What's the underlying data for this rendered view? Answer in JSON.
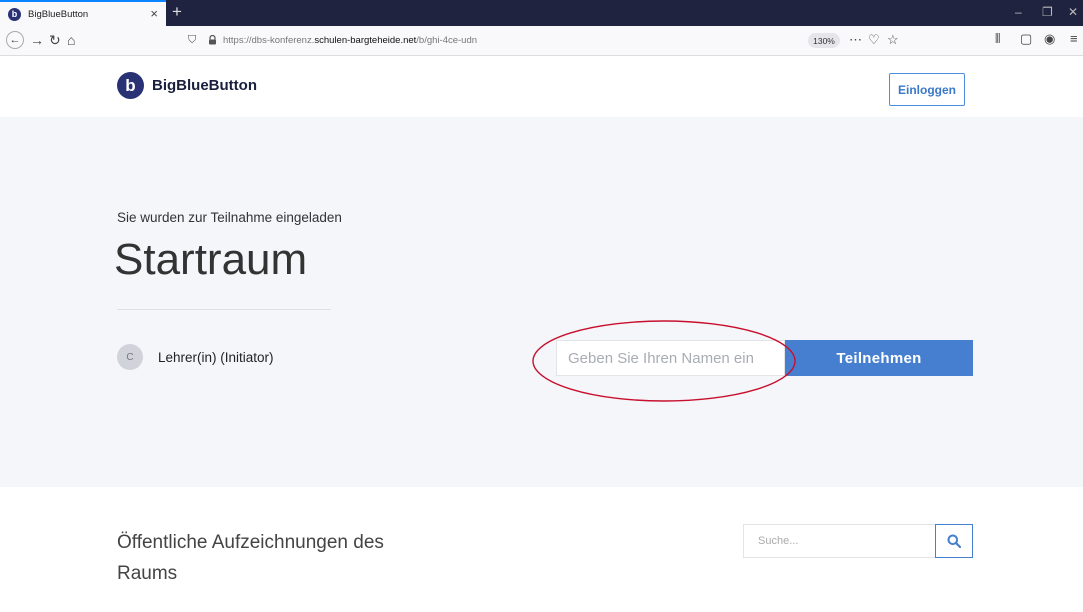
{
  "browser": {
    "tab_title": "BigBlueButton",
    "tab_favicon": "b",
    "url_prefix": "https://dbs-konferenz.",
    "url_host": "schulen-bargteheide.net",
    "url_path": "/b/ghi-4ce-udn",
    "zoom": "130%",
    "icons": [
      "back-arrow-icon",
      "forward-arrow-icon",
      "reload-icon",
      "home-icon",
      "shield-icon",
      "lock-icon",
      "more-icon",
      "pocket-icon",
      "star-icon",
      "library-icon",
      "sidebar-icon",
      "account-icon",
      "menu-icon"
    ]
  },
  "header": {
    "logo_letter": "b",
    "logo_text": "BigBlueButton",
    "login_label": "Einloggen"
  },
  "hero": {
    "invited_text": "Sie wurden zur Teilnahme eingeladen",
    "room_name": "Startraum",
    "owner_initial": "C",
    "owner_text": "Lehrer(in)  (Initiator)",
    "name_placeholder": "Geben Sie Ihren Namen ein",
    "join_label": "Teilnehmen"
  },
  "recordings": {
    "title": "Öffentliche Aufzeichnungen des Raums",
    "search_placeholder": "Suche..."
  },
  "colors": {
    "brand": "#283274",
    "primary": "#467fcf",
    "hero_bg": "#f5f6fa",
    "annotation": "#c8102e"
  }
}
